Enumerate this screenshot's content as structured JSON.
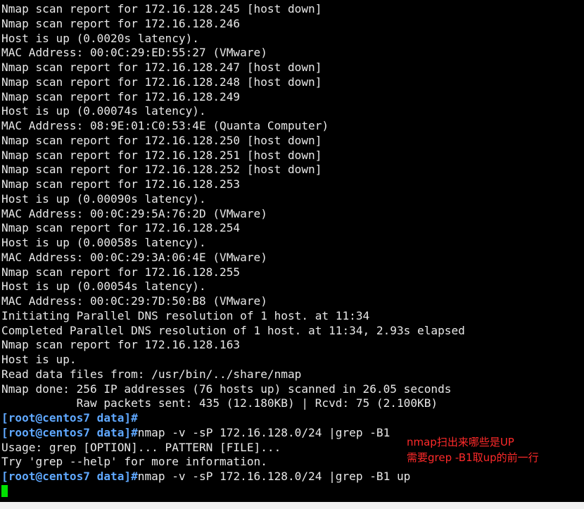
{
  "terminal": {
    "lines": [
      "Nmap scan report for 172.16.128.245 [host down]",
      "Nmap scan report for 172.16.128.246",
      "Host is up (0.0020s latency).",
      "MAC Address: 00:0C:29:ED:55:27 (VMware)",
      "Nmap scan report for 172.16.128.247 [host down]",
      "Nmap scan report for 172.16.128.248 [host down]",
      "Nmap scan report for 172.16.128.249",
      "Host is up (0.00074s latency).",
      "MAC Address: 08:9E:01:C0:53:4E (Quanta Computer)",
      "Nmap scan report for 172.16.128.250 [host down]",
      "Nmap scan report for 172.16.128.251 [host down]",
      "Nmap scan report for 172.16.128.252 [host down]",
      "Nmap scan report for 172.16.128.253",
      "Host is up (0.00090s latency).",
      "MAC Address: 00:0C:29:5A:76:2D (VMware)",
      "Nmap scan report for 172.16.128.254",
      "Host is up (0.00058s latency).",
      "MAC Address: 00:0C:29:3A:06:4E (VMware)",
      "Nmap scan report for 172.16.128.255",
      "Host is up (0.00054s latency).",
      "MAC Address: 00:0C:29:7D:50:B8 (VMware)",
      "Initiating Parallel DNS resolution of 1 host. at 11:34",
      "Completed Parallel DNS resolution of 1 host. at 11:34, 2.93s elapsed",
      "Nmap scan report for 172.16.128.163",
      "Host is up.",
      "Read data files from: /usr/bin/../share/nmap",
      "Nmap done: 256 IP addresses (76 hosts up) scanned in 26.05 seconds",
      "           Raw packets sent: 435 (12.180KB) | Rcvd: 75 (2.100KB)"
    ],
    "prompt": "[root@centos7 data]#",
    "command_1": "",
    "command_2": "nmap -v -sP 172.16.128.0/24 |grep -B1",
    "usage_line": "Usage: grep [OPTION]... PATTERN [FILE]...",
    "help_line": "Try 'grep --help' for more information.",
    "command_3": "nmap -v -sP 172.16.128.0/24 |grep -B1 up"
  },
  "annotation": {
    "line_1": "nmap扫出来哪些是UP",
    "line_2": "需要grep -B1取up的前一行",
    "color": "#ff2a2a"
  },
  "colors": {
    "background": "#000000",
    "text": "#e8e8e8",
    "prompt": "#5fa8ff",
    "cursor": "#00e000"
  }
}
